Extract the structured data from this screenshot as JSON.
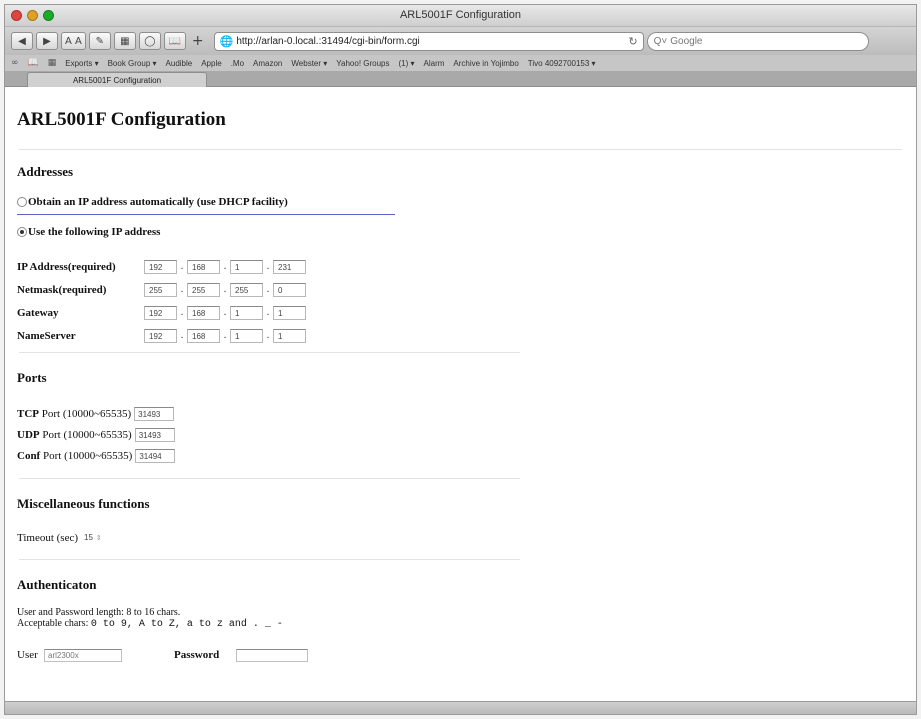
{
  "window": {
    "title": "ARL5001F Configuration"
  },
  "toolbar": {
    "back_icon": "back-arrow-icon",
    "forward_icon": "forward-arrow-icon",
    "url": "http://arlan-0.local.:31494/cgi-bin/form.cgi",
    "search_placeholder": "Google",
    "search_glyph": "Q˅"
  },
  "bookmarks": [
    "Exports ▾",
    "Book Group ▾",
    "Audible",
    "Apple",
    ".Mo",
    "Amazon",
    "Webster ▾",
    "Yahoo! Groups",
    "(1) ▾",
    "Alarm",
    "Archive in Yojimbo",
    "Tivo 4092700153 ▾"
  ],
  "tab": {
    "label": "ARL5001F Configuration"
  },
  "page": {
    "title": "ARL5001F Configuration",
    "addresses": {
      "heading": "Addresses",
      "dhcp_label": "Obtain an IP address automatically (use DHCP facility)",
      "static_label": "Use the following IP address",
      "selected": "static",
      "rows": [
        {
          "label": "IP Address(required)",
          "octets": [
            "192",
            "168",
            "1",
            "231"
          ]
        },
        {
          "label": "Netmask(required)",
          "octets": [
            "255",
            "255",
            "255",
            "0"
          ]
        },
        {
          "label": "Gateway",
          "octets": [
            "192",
            "168",
            "1",
            "1"
          ]
        },
        {
          "label": "NameServer",
          "octets": [
            "192",
            "168",
            "1",
            "1"
          ]
        }
      ]
    },
    "ports": {
      "heading": "Ports",
      "rows": [
        {
          "name": "TCP",
          "rest": " Port (10000~65535)",
          "value": "31493"
        },
        {
          "name": "UDP",
          "rest": " Port (10000~65535)",
          "value": "31493"
        },
        {
          "name": "Conf",
          "rest": " Port (10000~65535)",
          "value": "31494"
        }
      ]
    },
    "misc": {
      "heading": "Miscellaneous functions",
      "timeout_label": "Timeout (sec)",
      "timeout_value": "15"
    },
    "auth": {
      "heading": "Authenticaton",
      "note_line1": "User and Password length: 8 to 16 chars.",
      "note_line2_prefix": "Acceptable chars: ",
      "note_line2_chars": "0 to 9, A to Z, a to z and . _ -",
      "user_label": "User",
      "user_value": "arl2300x",
      "password_label": "Password",
      "password_value": ""
    }
  }
}
